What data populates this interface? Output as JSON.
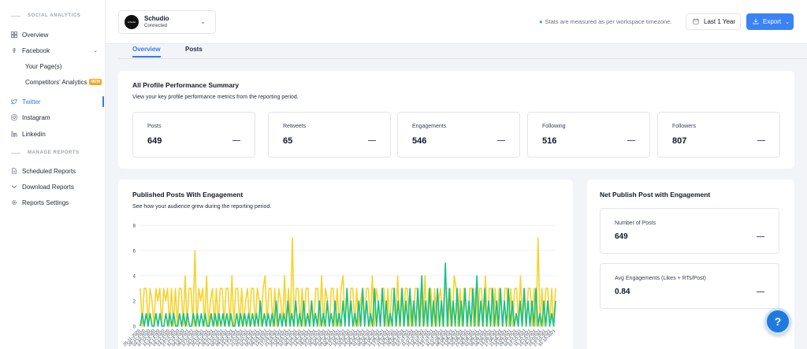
{
  "sidebar": {
    "section_social": "SOCIAL ANALYTICS",
    "overview": "Overview",
    "facebook": "Facebook",
    "your_pages": "Your Page(s)",
    "competitors": "Competitors' Analytics",
    "new_badge": "NEW",
    "twitter": "Twitter",
    "instagram": "Instagram",
    "linkedin": "Linkedin",
    "section_reports": "MANAGE REPORTS",
    "scheduled": "Scheduled Reports",
    "download": "Download Reports",
    "settings": "Reports Settings"
  },
  "account": {
    "name": "Schudio",
    "status": "Connected",
    "logo_text": "schudio"
  },
  "timezone_note": "Stats are measured as per workspace timezone.",
  "period_button": "Last 1 Year",
  "export_button": "Export",
  "tabs": [
    "Overview",
    "Posts"
  ],
  "summary": {
    "title": "All Profile Performance Summary",
    "subtitle": "View your key profile performance metrics from the reporting period.",
    "metrics": [
      {
        "label": "Posts",
        "value": "649"
      },
      {
        "label": "Retweets",
        "value": "65"
      },
      {
        "label": "Engagements",
        "value": "546"
      },
      {
        "label": "Following",
        "value": "516"
      },
      {
        "label": "Followers",
        "value": "807"
      }
    ]
  },
  "engagement_chart": {
    "title": "Published Posts With Engagement",
    "subtitle": "See how your audience grew during the reporting period."
  },
  "net_publish": {
    "title": "Net Publish Post with Engagement",
    "items": [
      {
        "label": "Number of Posts",
        "value": "649"
      },
      {
        "label": "Avg Engagements (Likes + RTs/Post)",
        "value": "0.84"
      }
    ]
  },
  "help_button": "?",
  "colors": {
    "accent": "#2f7de1",
    "posts_series": "#f6d32d",
    "engagement_series": "#17c08a",
    "export_bg": "#3b82f6"
  },
  "chart_data": {
    "type": "line",
    "title": "",
    "xlabel": "",
    "ylabel": "",
    "ylim": [
      0,
      8
    ],
    "yticks": [
      0,
      2,
      4,
      6,
      8
    ],
    "grid": true,
    "x_tick_labels": [
      "25-11-2020",
      "29-11-2020",
      "03-12-2020",
      "07-12-2020",
      "11-12-2020",
      "15-12-2020",
      "19-12-2020",
      "23-12-2020",
      "27-12-2020",
      "31-12-2020",
      "04-01-2021",
      "08-01-2021",
      "12-01-2021",
      "16-01-2021",
      "20-01-2021",
      "24-01-2021",
      "28-01-2021",
      "01-02-2021",
      "05-02-2021",
      "09-02-2021",
      "13-02-2021",
      "17-02-2021",
      "21-02-2021",
      "25-02-2021",
      "01-03-2021",
      "05-03-2021",
      "09-03-2021",
      "13-03-2021",
      "17-03-2021",
      "21-03-2021",
      "25-03-2021",
      "29-03-2021",
      "02-04-2021",
      "06-04-2021",
      "10-04-2021",
      "14-04-2021",
      "18-04-2021",
      "22-04-2021",
      "26-04-2021",
      "30-04-2021",
      "04-05-2021",
      "08-05-2021",
      "12-05-2021",
      "16-05-2021",
      "20-05-2021",
      "24-05-2021",
      "28-05-2021",
      "01-06-2021",
      "05-06-2021",
      "09-06-2021",
      "13-06-2021",
      "17-06-2021",
      "21-06-2021",
      "25-06-2021",
      "29-06-2021",
      "03-07-2021",
      "07-07-2021",
      "11-07-2021",
      "15-07-2021",
      "19-07-2021",
      "23-07-2021",
      "27-07-2021",
      "31-07-2021",
      "04-08-2021",
      "08-08-2021",
      "12-08-2021",
      "16-08-2021",
      "20-08-2021",
      "24-08-2021",
      "28-08-2021",
      "01-09-2021",
      "05-09-2021",
      "09-09-2021",
      "13-09-2021",
      "17-09-2021",
      "21-09-2021",
      "25-09-2021",
      "29-09-2021",
      "03-10-2021",
      "07-10-2021",
      "11-10-2021",
      "15-10-2021",
      "19-10-2021",
      "23-10-2021",
      "27-10-2021",
      "31-10-2021"
    ],
    "series": [
      {
        "color": "#f6d32d",
        "values": [
          3,
          0,
          3,
          3,
          0,
          3,
          2,
          0,
          3,
          2,
          3,
          0,
          3,
          2,
          3,
          0,
          3,
          0,
          3,
          0,
          3,
          3,
          0,
          4,
          0,
          3,
          3,
          0,
          6,
          0,
          3,
          2,
          3,
          0,
          4,
          0,
          2,
          3,
          0,
          3,
          0,
          3,
          3,
          0,
          3,
          3,
          0,
          4,
          0,
          3,
          3,
          0,
          3,
          0,
          2,
          3,
          0,
          3,
          3,
          0,
          3,
          2,
          0,
          3,
          4,
          0,
          3,
          3,
          0,
          3,
          0,
          3,
          2,
          0,
          4,
          0,
          3,
          0,
          7,
          0,
          3,
          3,
          0,
          3,
          0,
          3,
          3,
          0,
          2,
          0,
          3,
          3,
          0,
          4,
          0,
          3,
          2,
          0,
          3,
          3,
          0,
          3,
          0,
          3,
          4,
          0,
          3,
          0,
          3,
          3,
          0,
          3,
          0,
          2,
          3,
          0,
          3,
          3,
          0,
          4,
          0,
          3,
          2,
          0,
          3,
          3,
          0,
          3,
          0,
          3,
          3,
          0,
          4,
          0,
          3,
          0,
          3,
          3,
          0,
          2,
          0,
          3,
          3,
          0,
          3,
          0,
          4,
          0,
          3,
          3,
          0,
          3,
          0,
          2,
          3,
          0,
          3,
          3,
          0,
          3,
          0,
          4,
          3,
          0,
          3,
          0,
          3,
          2,
          0,
          3,
          3,
          0,
          3,
          0,
          3,
          3,
          0,
          4,
          0,
          3,
          3,
          0,
          3,
          0,
          3,
          2,
          0,
          3,
          3,
          0,
          3,
          0,
          3,
          3,
          0,
          4,
          0,
          3,
          0,
          3,
          3,
          0,
          3,
          0,
          7,
          0,
          3,
          0,
          3,
          3,
          0,
          3,
          0,
          3
        ]
      },
      {
        "color": "#17c08a",
        "values": [
          0,
          1,
          0,
          1,
          0,
          1,
          0,
          0,
          1,
          0,
          1,
          0,
          0,
          1,
          0,
          1,
          0,
          1,
          0,
          0,
          1,
          0,
          1,
          0,
          1,
          0,
          0,
          1,
          0,
          1,
          0,
          1,
          0,
          1,
          0,
          0,
          1,
          0,
          1,
          0,
          1,
          0,
          1,
          0,
          1,
          0,
          1,
          0,
          0,
          1,
          0,
          1,
          0,
          1,
          0,
          1,
          0,
          1,
          0,
          1,
          0,
          2,
          0,
          1,
          0,
          1,
          0,
          1,
          0,
          2,
          0,
          1,
          0,
          1,
          0,
          2,
          0,
          1,
          0,
          2,
          0,
          1,
          0,
          2,
          0,
          1,
          0,
          2,
          0,
          1,
          0,
          2,
          0,
          1,
          0,
          2,
          0,
          1,
          0,
          2,
          0,
          1,
          0,
          2,
          0,
          3,
          0,
          2,
          0,
          1,
          0,
          2,
          0,
          3,
          0,
          2,
          0,
          1,
          0,
          3,
          0,
          2,
          0,
          3,
          0,
          2,
          0,
          1,
          0,
          3,
          0,
          2,
          0,
          3,
          0,
          2,
          0,
          3,
          0,
          2,
          0,
          3,
          0,
          4,
          0,
          2,
          0,
          3,
          0,
          2,
          0,
          3,
          0,
          2,
          0,
          5,
          0,
          3,
          0,
          2,
          0,
          3,
          0,
          2,
          0,
          3,
          0,
          2,
          0,
          3,
          0,
          4,
          0,
          2,
          0,
          3,
          0,
          2,
          0,
          3,
          0,
          2,
          0,
          3,
          0,
          2,
          0,
          3,
          0,
          2,
          0,
          1,
          0,
          2,
          0,
          3,
          0,
          2,
          0,
          2,
          0,
          3,
          0,
          1,
          0,
          2,
          0,
          2,
          0,
          1,
          0,
          2
        ]
      }
    ]
  }
}
